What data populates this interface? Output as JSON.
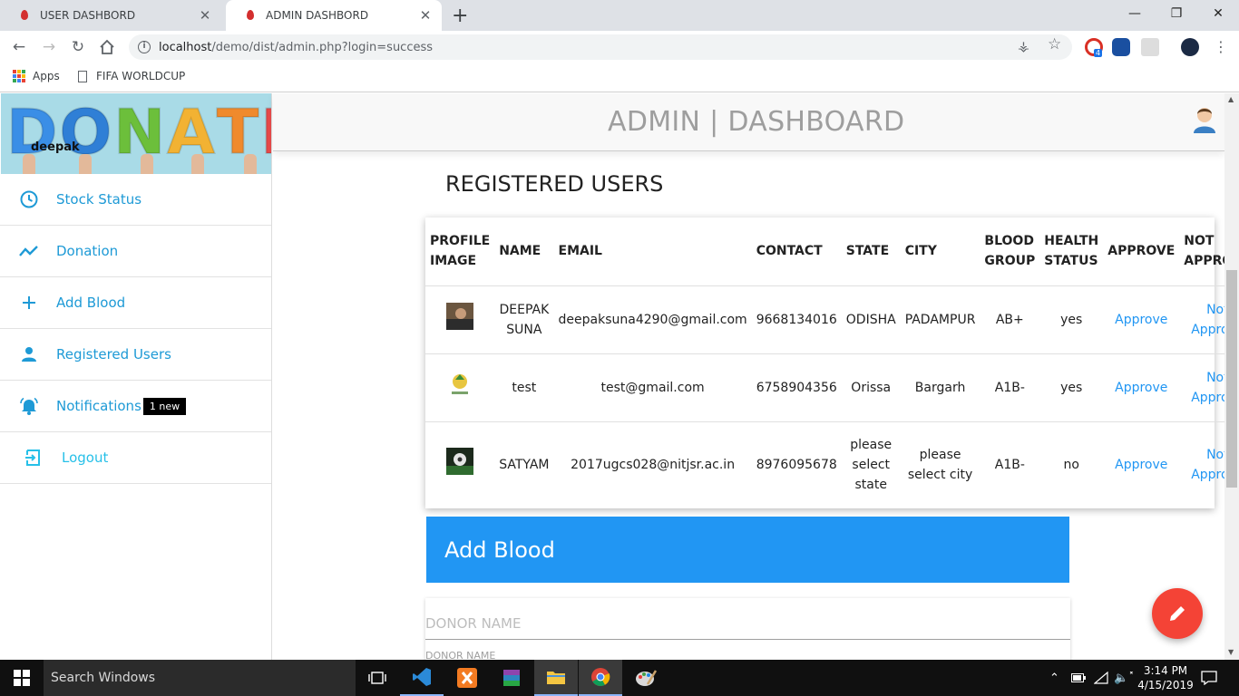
{
  "browser": {
    "tabs": [
      {
        "title": "USER DASHBORD",
        "active": false
      },
      {
        "title": "ADMIN DASHBORD",
        "active": true
      }
    ],
    "new_tab": "+",
    "address": {
      "host": "localhost",
      "path": "/demo/dist/admin.php?login=success"
    },
    "bookmarks": {
      "apps": "Apps",
      "fifa": "FIFA WORLDCUP"
    },
    "extension_badge": "4"
  },
  "sidebar": {
    "logo_text": "DONATE",
    "username": "deepak",
    "items": [
      {
        "label": "Stock Status",
        "icon": "clock-icon"
      },
      {
        "label": "Donation",
        "icon": "trending-icon"
      },
      {
        "label": "Add Blood",
        "icon": "plus-icon"
      },
      {
        "label": "Registered Users",
        "icon": "person-icon"
      },
      {
        "label": "Notifications",
        "icon": "bell-icon",
        "badge": "1 new"
      },
      {
        "label": "Logout",
        "icon": "logout-icon"
      }
    ]
  },
  "header": {
    "title": "ADMIN | DASHBOARD"
  },
  "users": {
    "section_title": "REGISTERED USERS",
    "headers": [
      "PROFILE IMAGE",
      "NAME",
      "EMAIL",
      "CONTACT",
      "STATE",
      "CITY",
      "BLOOD GROUP",
      "HEALTH STATUS",
      "APPROVE",
      "NOT APPROVE"
    ],
    "rows": [
      {
        "name": "DEEPAK SUNA",
        "email": "deepaksuna4290@gmail.com",
        "contact": "9668134016",
        "state": "ODISHA",
        "city": "PADAMPUR",
        "blood": "AB+",
        "health": "yes",
        "approve": "Approve",
        "not_approve": "Not Approve"
      },
      {
        "name": "test",
        "email": "test@gmail.com",
        "contact": "6758904356",
        "state": "Orissa",
        "city": "Bargarh",
        "blood": "A1B-",
        "health": "yes",
        "approve": "Approve",
        "not_approve": "Not Approve"
      },
      {
        "name": "SATYAM",
        "email": "2017ugcs028@nitjsr.ac.in",
        "contact": "8976095678",
        "state": "please select state",
        "city": "please select city",
        "blood": "A1B-",
        "health": "no",
        "approve": "Approve",
        "not_approve": "Not Approve"
      }
    ]
  },
  "add_blood": {
    "title": "Add Blood",
    "donor_placeholder": "DONOR NAME",
    "donor_label": "DONOR NAME"
  },
  "taskbar": {
    "search_placeholder": "Search Windows",
    "time": "3:14 PM",
    "date": "4/15/2019"
  },
  "colors": {
    "accent": "#2196f3",
    "menu_text": "#1e9ad6",
    "fab": "#f44336",
    "header_title": "#9e9e9e"
  }
}
